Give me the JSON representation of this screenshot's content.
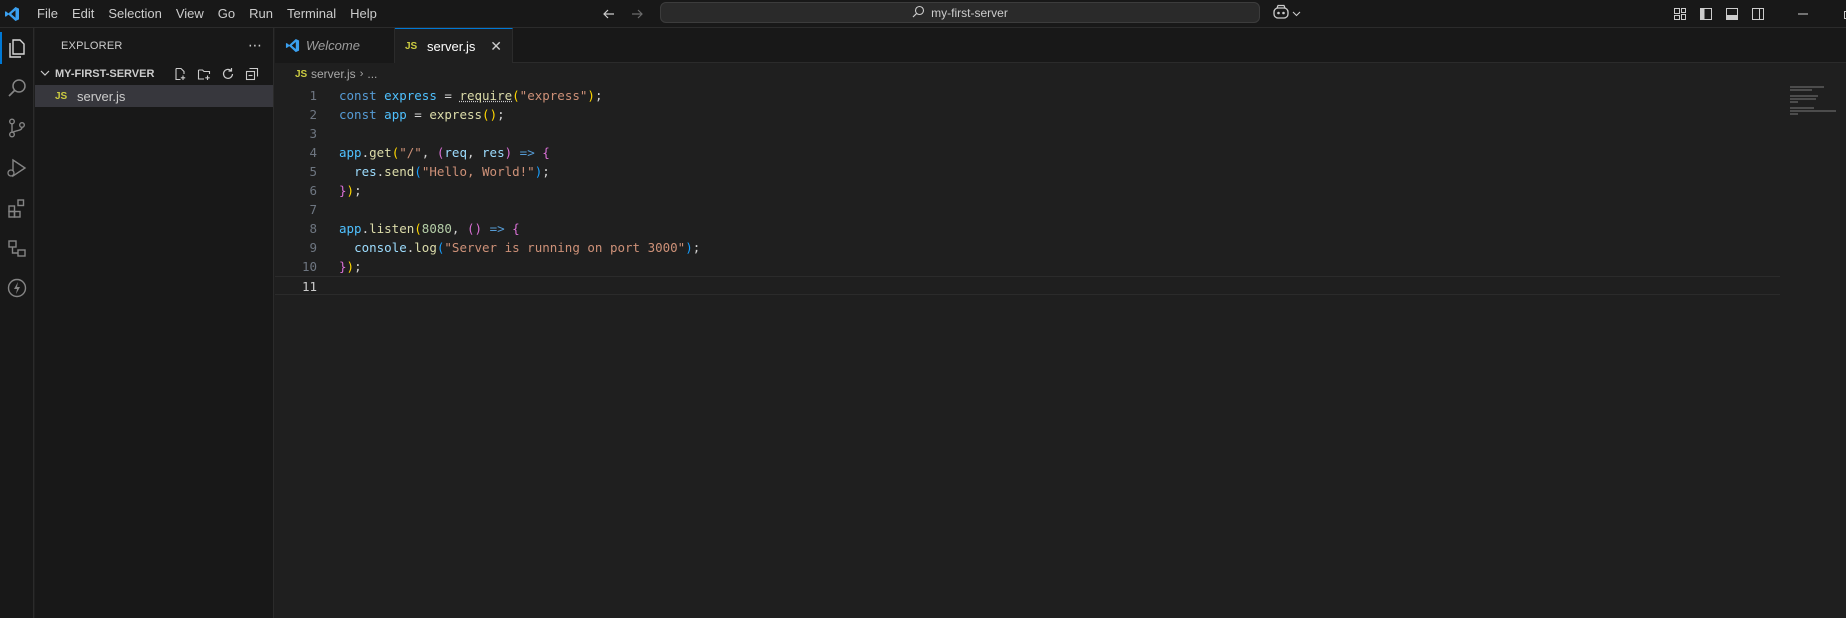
{
  "titlebar": {
    "menu": [
      "File",
      "Edit",
      "Selection",
      "View",
      "Go",
      "Run",
      "Terminal",
      "Help"
    ],
    "search_text": "my-first-server"
  },
  "sidebar": {
    "title": "EXPLORER",
    "folder_name": "MY-FIRST-SERVER",
    "files": [
      {
        "badge": "JS",
        "name": "server.js"
      }
    ]
  },
  "tabs": [
    {
      "label": "Welcome",
      "active": false
    },
    {
      "label": "server.js",
      "badge": "JS",
      "active": true
    }
  ],
  "breadcrumb": {
    "badge": "JS",
    "file": "server.js",
    "separator": "›",
    "more": "..."
  },
  "editor": {
    "active_line": 11,
    "lines": [
      "const express = require(\"express\");",
      "const app = express();",
      "",
      "app.get(\"/\", (req, res) => {",
      "  res.send(\"Hello, World!\");",
      "});",
      "",
      "app.listen(8080, () => {",
      "  console.log(\"Server is running on port 3000\");",
      "});",
      ""
    ]
  },
  "colors": {
    "accent": "#0078d4",
    "keyword": "#569cd6",
    "string": "#ce9178",
    "function": "#dcdcaa",
    "number": "#b5cea8",
    "js_badge": "#cbcb41"
  },
  "icons": {
    "app": "vscode-logo-icon",
    "activity": [
      "explorer-icon",
      "search-icon",
      "source-control-icon",
      "run-debug-icon",
      "extensions-icon",
      "remote-explorer-icon",
      "thunder-client-icon"
    ]
  }
}
